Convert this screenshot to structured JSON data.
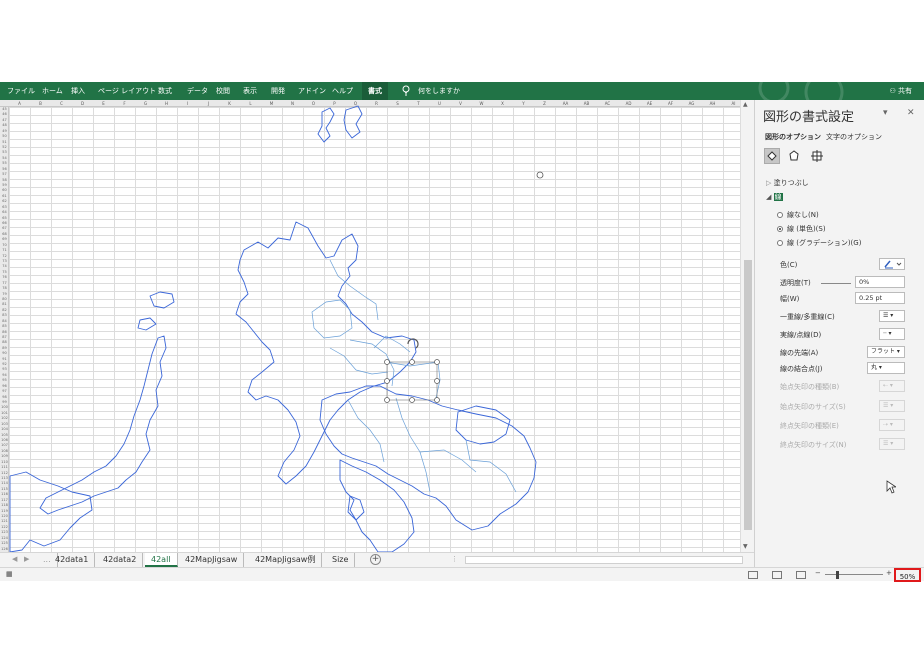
{
  "ribbon": {
    "tabs": [
      "ファイル",
      "ホーム",
      "挿入",
      "ページ レイアウト",
      "数式",
      "データ",
      "校閲",
      "表示",
      "開発",
      "アドイン",
      "ヘルプ",
      "書式"
    ],
    "active_tab": "書式",
    "tell_me": "何をしますか",
    "share": "共有",
    "color": "#217346"
  },
  "sheet": {
    "column_headers": [
      "A",
      "B",
      "C",
      "D",
      "E",
      "F",
      "G",
      "H",
      "I",
      "J",
      "K",
      "L",
      "M",
      "N",
      "O",
      "P",
      "Q",
      "R",
      "S",
      "T",
      "U",
      "V",
      "W",
      "X",
      "Y",
      "Z",
      "AA",
      "AB",
      "AC",
      "AD",
      "AE",
      "AF",
      "AG",
      "AH",
      "AI"
    ],
    "row_first": 45,
    "row_last": 126
  },
  "sheet_tabs": {
    "items": [
      "42data1",
      "42data2",
      "42all",
      "42MapJigsaw",
      "42MapJigsaw例",
      "Size"
    ],
    "active": "42all",
    "ellipsis": "..."
  },
  "format_pane": {
    "title": "図形の書式設定",
    "option_tabs": [
      "図形のオプション",
      "文字のオプション"
    ],
    "sections": {
      "fill": "塗りつぶし",
      "line": "線"
    },
    "radio_options": [
      "線なし(N)",
      "線 (単色)(S)",
      "線 (グラデーション)(G)"
    ],
    "selected_radio": "線 (単色)(S)",
    "properties": {
      "color": "色(C)",
      "transparency": "透明度(T)",
      "transparency_value": "0%",
      "width": "幅(W)",
      "width_value": "0.25 pt",
      "compound": "一重線/多重線(C)",
      "dash": "実線/点線(D)",
      "cap": "線の先端(A)",
      "cap_value": "フラット",
      "join": "線の結合点(J)",
      "join_value": "丸",
      "begin_arrow_type": "始点矢印の種類(B)",
      "begin_arrow_size": "始点矢印のサイズ(S)",
      "end_arrow_type": "終点矢印の種類(E)",
      "end_arrow_size": "終点矢印のサイズ(N)"
    }
  },
  "status_bar": {
    "zoom_level": "50%",
    "zoom_minus": "−",
    "zoom_plus": "+"
  },
  "map": {
    "line_color": "#3a66d8",
    "inner_border_color": "#6aa0d8"
  }
}
